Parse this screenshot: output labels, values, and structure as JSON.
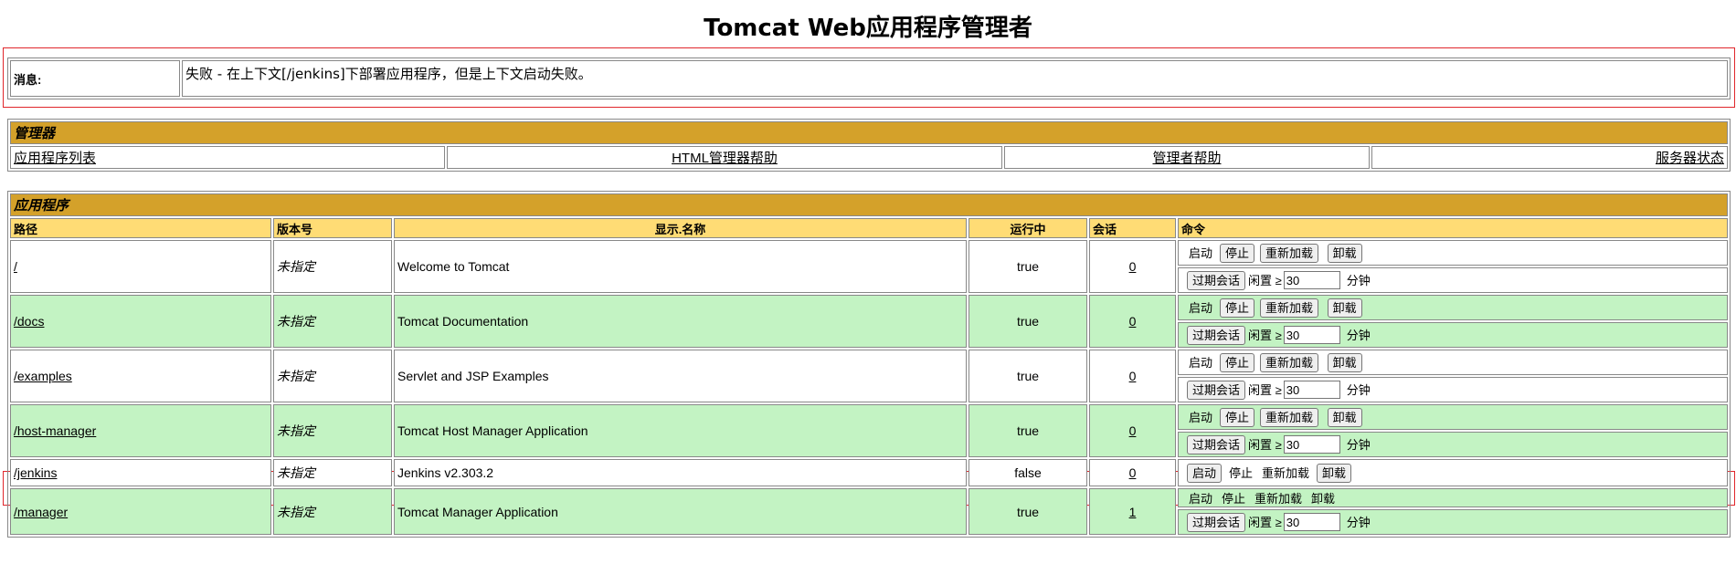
{
  "page": {
    "title": "Tomcat Web应用程序管理者"
  },
  "message": {
    "label": "消息:",
    "text": "失败 - 在上下文[/jenkins]下部署应用程序，但是上下文启动失败。"
  },
  "manager": {
    "header": "管理器",
    "links": [
      "应用程序列表",
      "HTML管理器帮助",
      "管理者帮助",
      "服务器状态"
    ]
  },
  "applications": {
    "header": "应用程序",
    "columns": [
      "路径",
      "版本号",
      "显示.名称",
      "运行中",
      "会话",
      "命令"
    ],
    "commands": {
      "start": "启动",
      "stop": "停止",
      "reload": "重新加载",
      "undeploy": "卸载",
      "expire": "过期会话",
      "idle": "闲置 ≥",
      "minutes": "分钟",
      "idle_default": "30"
    },
    "rows": [
      {
        "path": "/",
        "version": "未指定",
        "display": "Welcome to Tomcat",
        "running": "true",
        "sessions": "0"
      },
      {
        "path": "/docs",
        "version": "未指定",
        "display": "Tomcat Documentation",
        "running": "true",
        "sessions": "0"
      },
      {
        "path": "/examples",
        "version": "未指定",
        "display": "Servlet and JSP Examples",
        "running": "true",
        "sessions": "0"
      },
      {
        "path": "/host-manager",
        "version": "未指定",
        "display": "Tomcat Host Manager Application",
        "running": "true",
        "sessions": "0"
      },
      {
        "path": "/jenkins",
        "version": "未指定",
        "display": "Jenkins v2.303.2",
        "running": "false",
        "sessions": "0"
      },
      {
        "path": "/manager",
        "version": "未指定",
        "display": "Tomcat Manager Application",
        "running": "true",
        "sessions": "1"
      }
    ]
  },
  "colors": {
    "section_header": "#d4a12a",
    "column_header": "#ffdc75",
    "row_alt": "#c3f3c3",
    "highlight": "#e0262b"
  }
}
